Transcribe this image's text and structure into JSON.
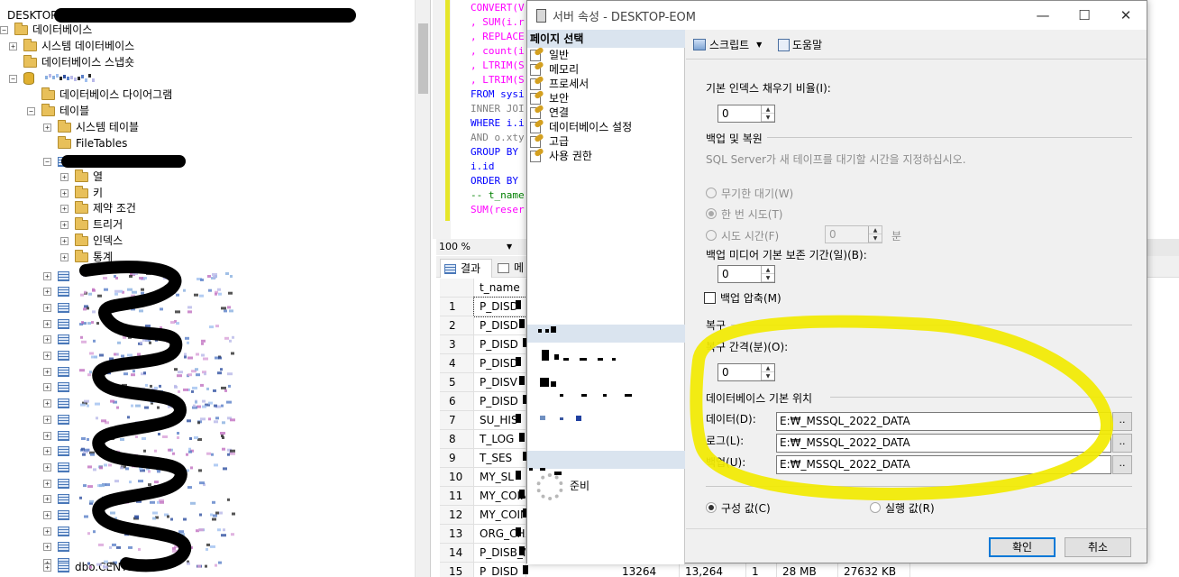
{
  "explorer": {
    "server_label": "DESKTOP",
    "tree": {
      "databases": "데이터베이스",
      "system_databases": "시스템 데이터베이스",
      "db_snapshots": "데이터베이스 스냅숏",
      "db_diagrams": "데이터베이스 다이어그램",
      "tables": "테이블",
      "system_tables": "시스템 테이블",
      "file_tables": "FileTables",
      "columns": "열",
      "keys": "키",
      "constraints": "제약 조건",
      "triggers": "트리거",
      "indexes": "인덱스",
      "statistics": "통계",
      "last_table": "dbo.CENTER"
    }
  },
  "editor": {
    "lines": [
      {
        "text": "CONVERT(V",
        "color": "pink"
      },
      {
        "text": ", SUM(i.r",
        "color": "pink"
      },
      {
        "text": ", REPLACE",
        "color": "pink"
      },
      {
        "text": ", count(i",
        "color": "pink"
      },
      {
        "text": ", LTRIM(S",
        "color": "pink"
      },
      {
        "text": ", LTRIM(S",
        "color": "pink"
      },
      {
        "text": "FROM sysi",
        "color": "blue"
      },
      {
        "text": "INNER JOI",
        "color": "gray"
      },
      {
        "text": "WHERE i.i",
        "color": "blue"
      },
      {
        "text": "AND o.xty",
        "color": "gray"
      },
      {
        "text": "GROUP BY",
        "color": "blue"
      },
      {
        "text": "i.id",
        "color": "blue"
      },
      {
        "text": "ORDER BY",
        "color": "blue"
      },
      {
        "text": "-- t_name",
        "color": "green"
      },
      {
        "text": "SUM(reser",
        "color": "pink"
      }
    ],
    "zoom": "100 %"
  },
  "results": {
    "tabs": {
      "results": "결과",
      "messages": "메"
    },
    "column_header": "t_name",
    "rows": [
      {
        "num": "1",
        "name": "P_DISD"
      },
      {
        "num": "2",
        "name": "P_DISD"
      },
      {
        "num": "3",
        "name": "P_DISD"
      },
      {
        "num": "4",
        "name": "P_DISD"
      },
      {
        "num": "5",
        "name": "P_DISV"
      },
      {
        "num": "6",
        "name": "P_DISD"
      },
      {
        "num": "7",
        "name": "SU_HIS"
      },
      {
        "num": "8",
        "name": "T_LOG"
      },
      {
        "num": "9",
        "name": "T_SES"
      },
      {
        "num": "10",
        "name": "MY_SL"
      },
      {
        "num": "11",
        "name": "MY_COIN"
      },
      {
        "num": "12",
        "name": "MY_COIN"
      },
      {
        "num": "13",
        "name": "ORG_CHA"
      },
      {
        "num": "14",
        "name": "P_DISB_M"
      },
      {
        "num": "15",
        "name": "P_DISD"
      }
    ],
    "last_row_extra": [
      "13264",
      "13,264",
      "1",
      "28 MB",
      "27632 KB"
    ]
  },
  "dialog": {
    "title": "서버 속성 - DESKTOP-EOM",
    "window_buttons": {
      "minimize": "—",
      "maximize": "☐",
      "close": "✕"
    },
    "page_select_header": "페이지 선택",
    "pages": [
      "일반",
      "메모리",
      "프로세서",
      "보안",
      "연결",
      "데이터베이스 설정",
      "고급",
      "사용 권한"
    ],
    "progress_label": "준비",
    "toolbar": {
      "script": "스크립트",
      "help": "도움말"
    },
    "settings": {
      "fill_factor_label": "기본 인덱스 채우기 비율(I):",
      "fill_factor_value": "0",
      "backup_restore_section": "백업 및 복원",
      "backup_desc": "SQL Server가 새 테이프를 대기할 시간을 지정하십시오.",
      "wait_infinite": "무기한 대기(W)",
      "try_once": "한 번 시도(T)",
      "try_time": "시도 시간(F)",
      "try_time_value": "0",
      "minutes_unit": "분",
      "retention_label": "백업 미디어 기본 보존 기간(일)(B):",
      "retention_value": "0",
      "compress_label": "백업 압축(M)",
      "recovery_section": "복구",
      "recovery_interval_label": "복구 간격(분)(O):",
      "recovery_interval_value": "0",
      "default_locations_section": "데이터베이스 기본 위치",
      "data_label": "데이터(D):",
      "data_path": "E:₩_MSSQL_2022_DATA",
      "log_label": "로그(L):",
      "log_path": "E:₩_MSSQL_2022_DATA",
      "backup_label": "백업(U):",
      "backup_path": "E:₩_MSSQL_2022_DATA",
      "browse": "..",
      "configured_values": "구성 값(C)",
      "running_values": "실행 값(R)"
    },
    "buttons": {
      "ok": "확인",
      "cancel": "취소"
    }
  },
  "colors": {
    "highlight": "#f2ea00",
    "accent": "#0078d7",
    "page_header": "#dae4ef"
  }
}
